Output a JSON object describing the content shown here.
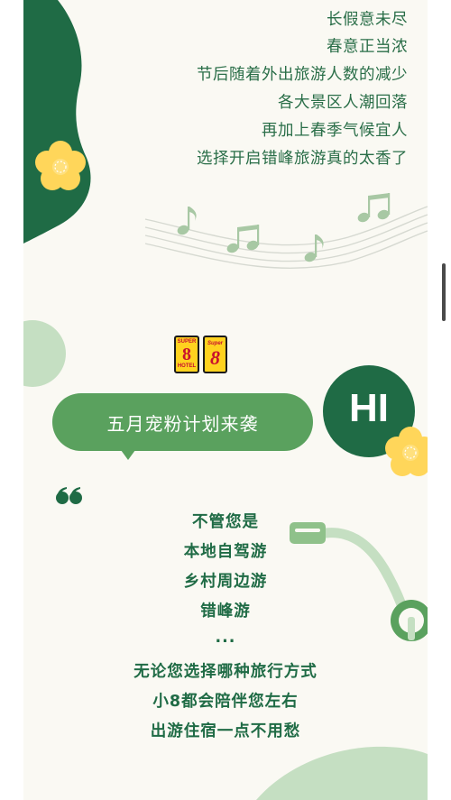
{
  "intro": {
    "lines": [
      "长假意未尽",
      "春意正当浓",
      "节后随着外出旅游人数的减少",
      "各大景区人潮回落",
      "再加上春季气候宜人",
      "选择开启错峰旅游真的太香了"
    ]
  },
  "brand": {
    "logo1": {
      "top": "SUPER",
      "big": "8",
      "bottom": "HOTEL"
    },
    "logo2": {
      "top": "Super",
      "big": "8"
    }
  },
  "banner": {
    "title": "五月宠粉计划来袭",
    "hi": "HI"
  },
  "body": {
    "lines": [
      "不管您是",
      "本地自驾游",
      "乡村周边游",
      "错峰游",
      "...",
      "无论您选择哪种旅行方式",
      "小8都会陪伴您左右",
      "出游住宿一点不用愁"
    ]
  },
  "colors": {
    "dark_green": "#1f6b45",
    "mid_green": "#5aa15e",
    "light_green": "#c5dfc2",
    "background": "#faf9f3",
    "flower_yellow": "#ffd65a"
  },
  "icons": [
    "flower-icon",
    "music-note-icon",
    "quote-mark-icon",
    "plug-icon"
  ]
}
